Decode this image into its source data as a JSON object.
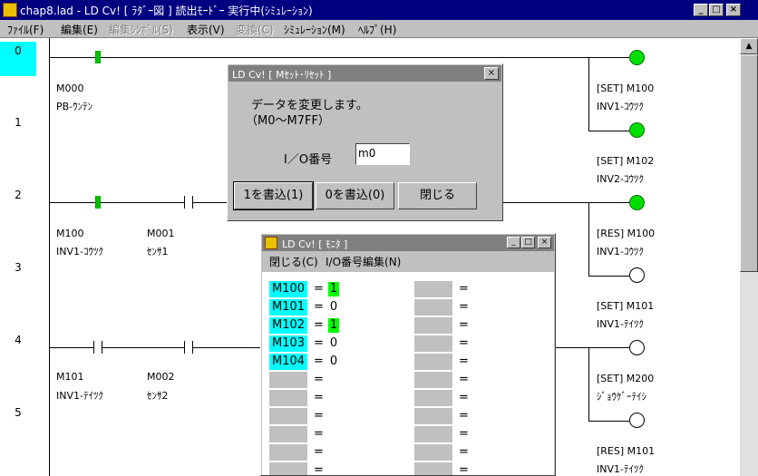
{
  "window": {
    "title": "chap8.lad - LD Cv! [ ﾗﾀﾞｰ図 ] 読出ﾓｰﾄﾞｰ 実行中(ｼﾐｭﾚｰｼｮﾝ)",
    "min": "_",
    "max": "□",
    "close": "×"
  },
  "menu": [
    "ﾌｧｲﾙ(F)",
    "編集(E)",
    "編集ｼﾝﾎﾞﾙ(S)",
    "表示(V)",
    "変換(C)",
    "ｼﾐｭﾚｰｼｮﾝ(M)",
    "ﾍﾙﾌﾟ(H)"
  ],
  "ladder": {
    "rows": [
      "0",
      "1",
      "2",
      "3",
      "4",
      "5"
    ],
    "contacts": [
      {
        "device": "M000",
        "comment": "PB-ｳﾝﾃﾝ",
        "on": true
      },
      {
        "device": "M100",
        "comment": "INV1-ｺｳﾂｸ",
        "on": true
      },
      {
        "device": "M001",
        "comment": "ｾﾝｻ1",
        "on": false
      },
      {
        "device": "M101",
        "comment": "INV1-ﾃｲﾂｸ",
        "on": false
      },
      {
        "device": "M002",
        "comment": "ｾﾝｻ2",
        "on": false
      }
    ],
    "coils": [
      {
        "instr": "[SET] M100",
        "comment": "INV1-ｺｳﾂｸ",
        "on": true
      },
      {
        "instr": "[SET] M102",
        "comment": "INV2-ｺｳﾂｸ",
        "on": true
      },
      {
        "instr": "[RES] M100",
        "comment": "INV1-ｺｳﾂｸ",
        "on": true
      },
      {
        "instr": "[SET] M101",
        "comment": "INV1-ﾃｲﾂｸ",
        "on": false
      },
      {
        "instr": "[SET] M200",
        "comment": "ｼﾞｮｳｹﾞｰﾃｲｼ",
        "on": false
      },
      {
        "instr": "[RES] M101",
        "comment": "INV1-ﾃｲﾂｸ",
        "on": false
      }
    ]
  },
  "dialog": {
    "title": "LD Cv! [ Mｾｯﾄ･ﾘｾｯﾄ ]",
    "message1": "データを変更します。",
    "message2": "（M0～M7FF）",
    "io_label": "I／O番号",
    "io_value": "m0",
    "btn_write1": "1を書込(1)",
    "btn_write0": "0を書込(0)",
    "btn_close": "閉じる",
    "close": "×"
  },
  "monitor": {
    "title": "LD Cv! [ ﾓﾆﾀ ]",
    "menu": [
      "閉じる(C)",
      "I/O番号編集(N)"
    ],
    "left_rows": [
      {
        "name": "M100",
        "value": "1",
        "on": true
      },
      {
        "name": "M101",
        "value": "0",
        "on": false
      },
      {
        "name": "M102",
        "value": "1",
        "on": true
      },
      {
        "name": "M103",
        "value": "0",
        "on": false
      },
      {
        "name": "M104",
        "value": "0",
        "on": false
      },
      {
        "name": "",
        "value": "",
        "on": false
      },
      {
        "name": "",
        "value": "",
        "on": false
      },
      {
        "name": "",
        "value": "",
        "on": false
      },
      {
        "name": "",
        "value": "",
        "on": false
      },
      {
        "name": "",
        "value": "",
        "on": false
      },
      {
        "name": "",
        "value": "",
        "on": false
      }
    ],
    "right_rows": 11,
    "eq": "="
  }
}
